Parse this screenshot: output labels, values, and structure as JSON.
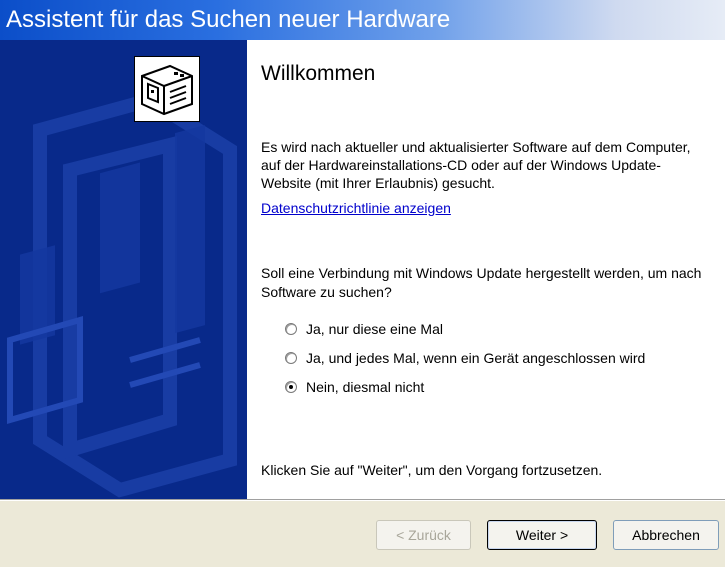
{
  "window": {
    "title": "Assistent für das Suchen neuer Hardware"
  },
  "content": {
    "heading": "Willkommen",
    "paragraph": "Es wird nach aktueller und aktualisierter Software auf dem Computer, auf der Hardwareinstallations-CD oder auf der Windows Update-Website (mit Ihrer Erlaubnis) gesucht.",
    "privacy_link": "Datenschutzrichtlinie anzeigen",
    "question": "Soll eine Verbindung mit Windows Update hergestellt werden, um nach Software zu suchen?",
    "options": [
      {
        "label": "Ja, nur diese eine Mal",
        "checked": false
      },
      {
        "label": "Ja, und jedes Mal, wenn ein Gerät angeschlossen wird",
        "checked": false
      },
      {
        "label": "Nein, diesmal nicht",
        "checked": true
      }
    ],
    "continue_hint": "Klicken Sie auf \"Weiter\", um den Vorgang fortzusetzen."
  },
  "buttons": {
    "back": "< Zurück",
    "next": "Weiter >",
    "cancel": "Abbrechen"
  },
  "colors": {
    "side_panel": "#08298a",
    "link": "#0000cc",
    "button_bar": "#ece9d8"
  },
  "icons": {
    "wizard": "hardware-card-icon"
  }
}
